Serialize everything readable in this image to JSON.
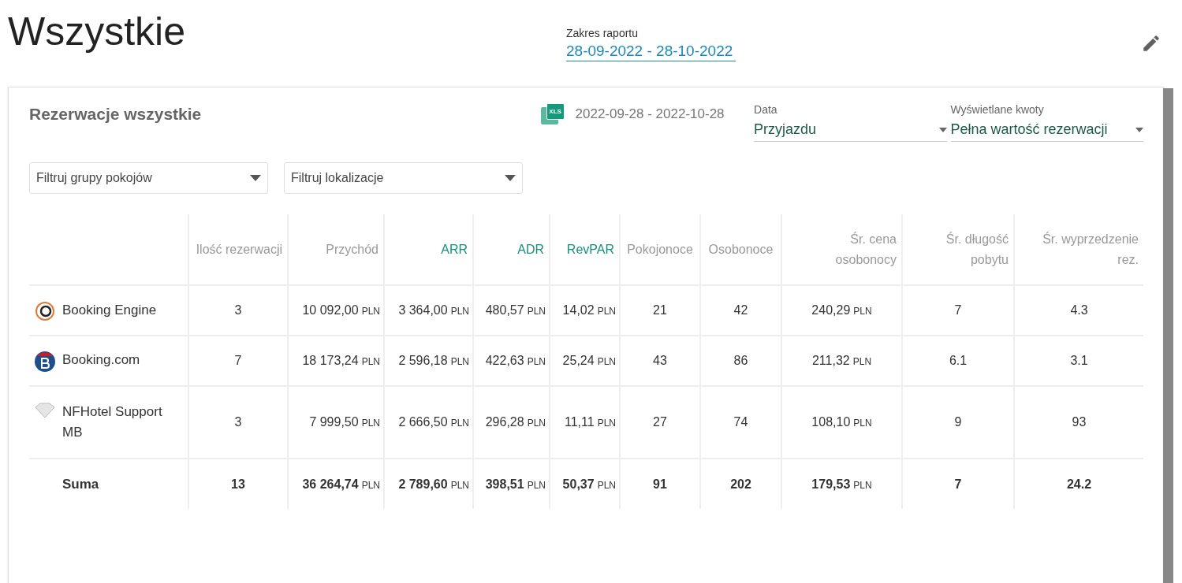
{
  "page": {
    "title": "Wszystkie",
    "range_label": "Zakres raportu",
    "range_value": "28-09-2022 - 28-10-2022"
  },
  "card": {
    "title": "Rezerwacje wszystkie",
    "export_label": "XLS",
    "export_dates": "2022-09-28 - 2022-10-28",
    "selects": [
      {
        "label": "Data",
        "value": "Przyjazdu"
      },
      {
        "label": "Wyświetlane kwoty",
        "value": "Pełna wartość rezerwacji"
      }
    ],
    "filters": [
      {
        "placeholder": "Filtruj grupy pokojów"
      },
      {
        "placeholder": "Filtruj lokalizacje"
      }
    ]
  },
  "table": {
    "columns": [
      {
        "kind": "blank"
      },
      {
        "kind": "label",
        "label": "Ilość rezerwacji",
        "highlight": false
      },
      {
        "kind": "label",
        "label": "Przychód",
        "highlight": false
      },
      {
        "kind": "label",
        "label": "ARR",
        "highlight": true
      },
      {
        "kind": "label",
        "label": "ADR",
        "highlight": true
      },
      {
        "kind": "label",
        "label": "RevPAR",
        "highlight": true
      },
      {
        "kind": "label",
        "label": "Pokojonoce",
        "highlight": false
      },
      {
        "kind": "label",
        "label": "Osobonoce",
        "highlight": false
      },
      {
        "kind": "label",
        "label": "Śr. cena osobonocy",
        "highlight": false
      },
      {
        "kind": "label",
        "label": "Śr. długość pobytu",
        "highlight": false
      },
      {
        "kind": "label",
        "label": "Śr. wyprzedzenie rez.",
        "highlight": false
      }
    ],
    "rows": [
      {
        "kind": "engine",
        "cells": [
          {
            "value": "Booking Engine"
          },
          {
            "value": "3"
          },
          {
            "value": "10 092,00",
            "unit": "PLN"
          },
          {
            "value": "3 364,00",
            "unit": "PLN"
          },
          {
            "value": "480,57",
            "unit": "PLN"
          },
          {
            "value": "14,02",
            "unit": "PLN"
          },
          {
            "value": "21"
          },
          {
            "value": "42"
          },
          {
            "value": "240,29",
            "unit": "PLN"
          },
          {
            "value": "7"
          },
          {
            "value": "4.3"
          }
        ]
      },
      {
        "kind": "booking",
        "cells": [
          {
            "value": "Booking.com"
          },
          {
            "value": "7"
          },
          {
            "value": "18 173,24",
            "unit": "PLN"
          },
          {
            "value": "2 596,18",
            "unit": "PLN"
          },
          {
            "value": "422,63",
            "unit": "PLN"
          },
          {
            "value": "25,24",
            "unit": "PLN"
          },
          {
            "value": "43"
          },
          {
            "value": "86"
          },
          {
            "value": "211,32",
            "unit": "PLN"
          },
          {
            "value": "6.1"
          },
          {
            "value": "3.1"
          }
        ]
      },
      {
        "kind": "support",
        "cells": [
          {
            "value": "NFHotel Support MB"
          },
          {
            "value": "3"
          },
          {
            "value": "7 999,50",
            "unit": "PLN"
          },
          {
            "value": "2 666,50",
            "unit": "PLN"
          },
          {
            "value": "296,28",
            "unit": "PLN"
          },
          {
            "value": "11,11",
            "unit": "PLN"
          },
          {
            "value": "27"
          },
          {
            "value": "74"
          },
          {
            "value": "108,10",
            "unit": "PLN"
          },
          {
            "value": "9"
          },
          {
            "value": "93"
          }
        ]
      },
      {
        "kind": "total",
        "cells": [
          {
            "value": "Suma"
          },
          {
            "value": "13"
          },
          {
            "value": "36 264,74",
            "unit": "PLN"
          },
          {
            "value": "2 789,60",
            "unit": "PLN"
          },
          {
            "value": "398,51",
            "unit": "PLN"
          },
          {
            "value": "50,37",
            "unit": "PLN"
          },
          {
            "value": "91"
          },
          {
            "value": "202"
          },
          {
            "value": "179,53",
            "unit": "PLN"
          },
          {
            "value": "7"
          },
          {
            "value": "24.2"
          }
        ]
      }
    ]
  }
}
